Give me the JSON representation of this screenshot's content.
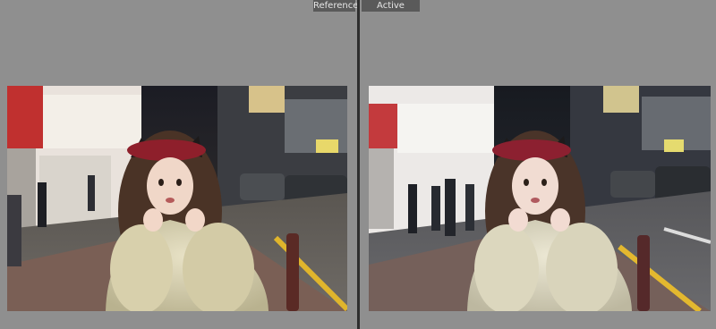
{
  "compare_view": {
    "reference_label": "Reference",
    "active_label": "Active"
  },
  "photos": {
    "reference": {
      "description_icon": "street-portrait-photo",
      "tone": "warm"
    },
    "active": {
      "description_icon": "street-portrait-photo",
      "tone": "neutral"
    }
  },
  "colors": {
    "panel_bg": "#8f8f8f",
    "divider": "#2e2e2e",
    "label_bg": "#5a5a5a",
    "label_text": "#e6e6e6"
  }
}
